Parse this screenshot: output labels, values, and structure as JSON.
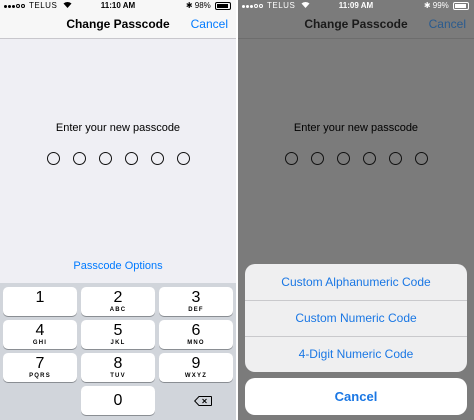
{
  "left": {
    "status": {
      "carrier": "TELUS",
      "time": "11:10 AM",
      "battery": "98%"
    },
    "nav": {
      "title": "Change Passcode",
      "cancel": "Cancel"
    },
    "prompt": "Enter your new passcode",
    "options_link": "Passcode Options",
    "keys": [
      {
        "num": "1",
        "letters": ""
      },
      {
        "num": "2",
        "letters": "ABC"
      },
      {
        "num": "3",
        "letters": "DEF"
      },
      {
        "num": "4",
        "letters": "GHI"
      },
      {
        "num": "5",
        "letters": "JKL"
      },
      {
        "num": "6",
        "letters": "MNO"
      },
      {
        "num": "7",
        "letters": "PQRS"
      },
      {
        "num": "8",
        "letters": "TUV"
      },
      {
        "num": "9",
        "letters": "WXYZ"
      },
      {
        "num": "0",
        "letters": ""
      }
    ]
  },
  "right": {
    "status": {
      "carrier": "TELUS",
      "time": "11:09 AM",
      "battery": "99%"
    },
    "nav": {
      "title": "Change Passcode",
      "cancel": "Cancel"
    },
    "prompt": "Enter your new passcode",
    "sheet": {
      "options": [
        "Custom Alphanumeric Code",
        "Custom Numeric Code",
        "4-Digit Numeric Code"
      ],
      "cancel": "Cancel"
    }
  },
  "colors": {
    "accent": "#007aff",
    "sheet_text": "#1a77e4",
    "dim_background": "#7b7b7b"
  }
}
